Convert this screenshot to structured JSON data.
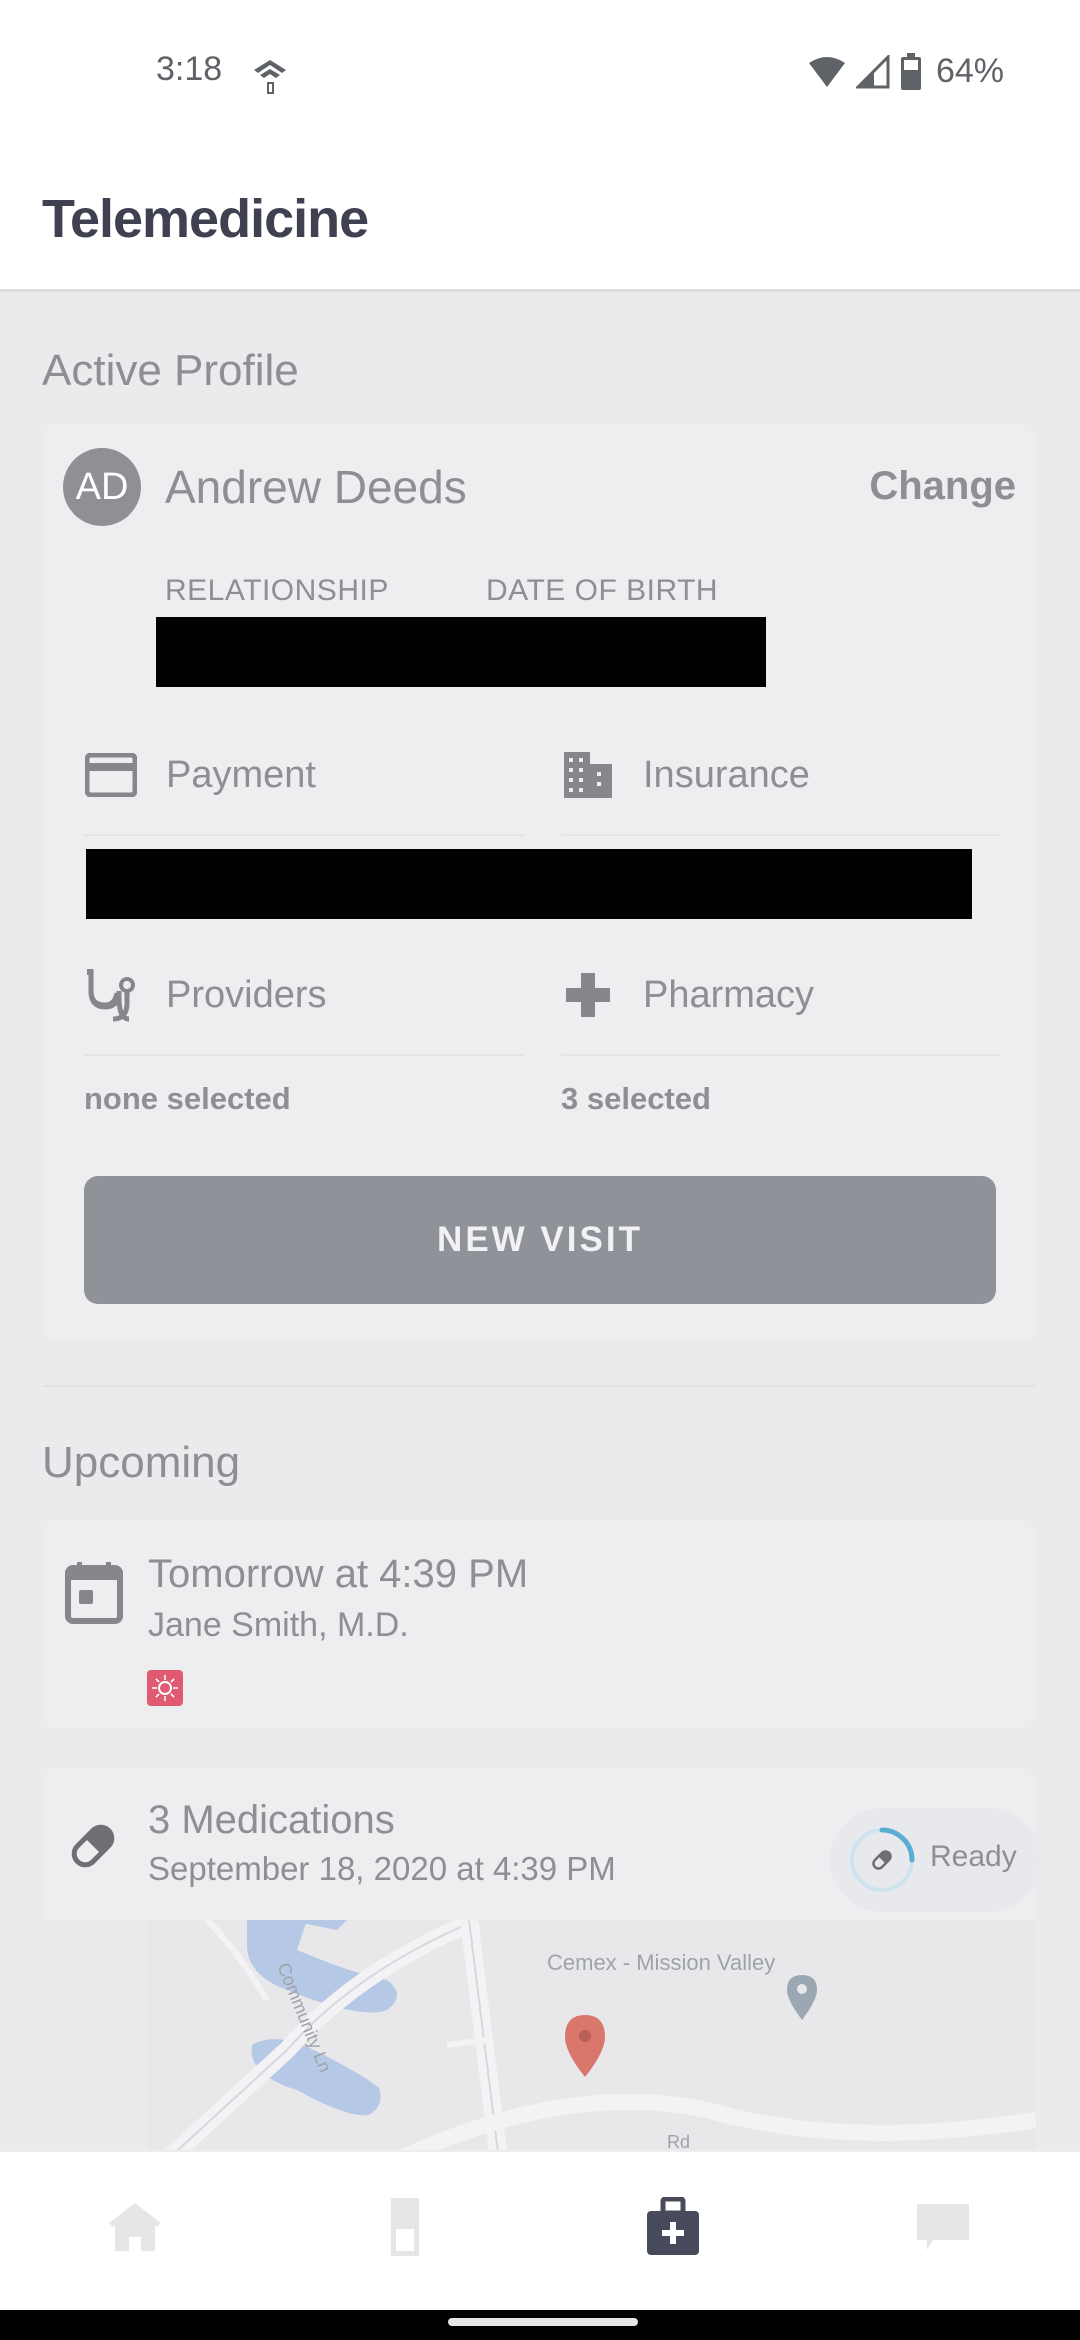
{
  "status_bar": {
    "time": "3:18",
    "battery_text": "64%",
    "icons": [
      "hotspot-icon",
      "wifi-icon",
      "cell-signal-icon",
      "battery-icon"
    ]
  },
  "header": {
    "title": "Telemedicine"
  },
  "active_profile": {
    "section_title": "Active Profile",
    "avatar_initials": "AD",
    "name": "Andrew Deeds",
    "change_label": "Change",
    "relationship_label": "RELATIONSHIP",
    "dob_label": "DATE OF BIRTH",
    "payment_label": "Payment",
    "insurance_label": "Insurance",
    "providers_label": "Providers",
    "providers_value": "none selected",
    "pharmacy_label": "Pharmacy",
    "pharmacy_value": "3 selected",
    "new_visit_label": "NEW VISIT"
  },
  "upcoming": {
    "section_title": "Upcoming",
    "appointment": {
      "title": "Tomorrow at 4:39 PM",
      "provider": "Jane Smith, M.D.",
      "badge_color": "#e15a71"
    },
    "medications": {
      "title": "3 Medications",
      "subtitle": "September 18, 2020 at 4:39 PM",
      "status_label": "Ready",
      "status_progress_fraction": 0.25,
      "map_place_label": "Cemex - Mission Valley",
      "map_street_label": "Community Ln",
      "map_road_label": "Rd"
    }
  },
  "bottom_nav": {
    "items": [
      {
        "name": "home",
        "active": false
      },
      {
        "name": "records",
        "active": false
      },
      {
        "name": "telemedicine",
        "active": true
      },
      {
        "name": "messages",
        "active": false
      }
    ]
  },
  "colors": {
    "text_gray": "#8e8e93",
    "title_dark": "#3f4150",
    "button_gray": "#8f9298",
    "accent_blue": "#5aaed3",
    "map_water": "#b5c8e6",
    "map_pin": "#d9776d"
  }
}
